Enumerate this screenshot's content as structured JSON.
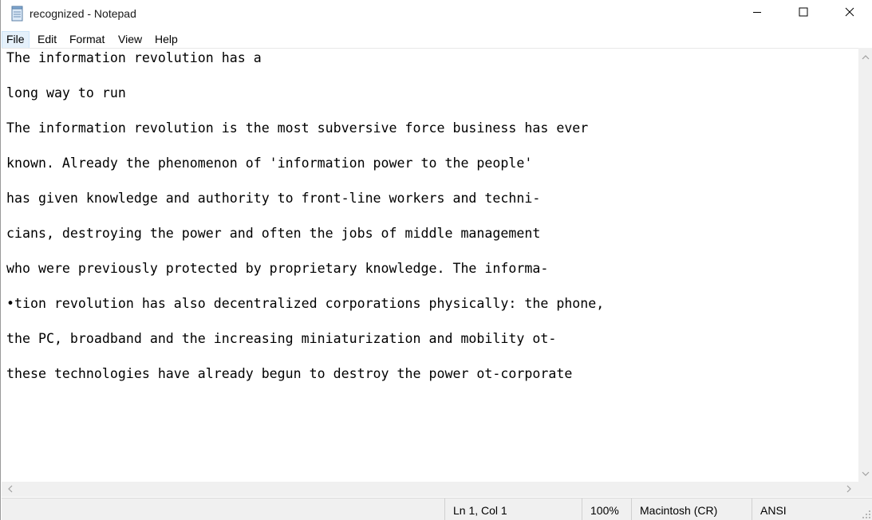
{
  "window": {
    "title": "recognized - Notepad"
  },
  "menu": {
    "items": [
      "File",
      "Edit",
      "Format",
      "View",
      "Help"
    ]
  },
  "editor": {
    "lines": [
      "The information revolution has a",
      "long way to run",
      "The information revolution is the most subversive force business has ever",
      "known. Already the phenomenon of 'information power to the people'",
      "has given knowledge and authority to front-line workers and techni-",
      "cians, destroying the power and often the jobs of middle management",
      "who were previously protected by proprietary knowledge. The informa-",
      "•tion revolution has also decentralized corporations physically: the phone,",
      "the PC, broadband and the increasing miniaturization and mobility ot-",
      "these technologies have already begun to destroy the power ot-corporate"
    ]
  },
  "status": {
    "position": "Ln 1, Col 1",
    "zoom": "100%",
    "line_ending": "Macintosh (CR)",
    "encoding": "ANSI"
  },
  "icons": {
    "app": "notepad-icon",
    "minimize": "minimize-icon",
    "maximize": "maximize-icon",
    "close": "close-icon"
  }
}
